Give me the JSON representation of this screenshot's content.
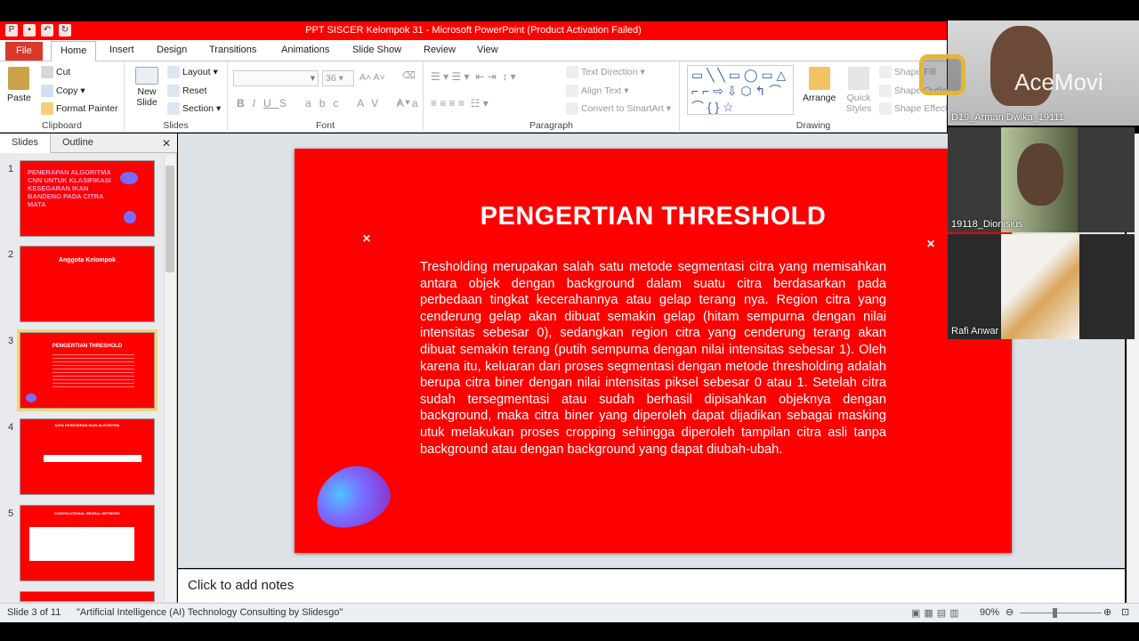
{
  "window": {
    "title": "PPT SISCER Kelompok 31 - Microsoft PowerPoint (Product Activation Failed)"
  },
  "ribbon_tabs": [
    "File",
    "Home",
    "Insert",
    "Design",
    "Transitions",
    "Animations",
    "Slide Show",
    "Review",
    "View"
  ],
  "clipboard": {
    "paste": "Paste",
    "cut": "Cut",
    "copy": "Copy",
    "format_painter": "Format Painter",
    "label": "Clipboard"
  },
  "slides_group": {
    "new_slide": "New Slide",
    "layout": "Layout",
    "reset": "Reset",
    "section": "Section",
    "label": "Slides"
  },
  "font_group": {
    "size": "36",
    "label": "Font"
  },
  "paragraph_group": {
    "text_direction": "Text Direction",
    "align_text": "Align Text",
    "convert": "Convert to SmartArt",
    "label": "Paragraph"
  },
  "drawing_group": {
    "arrange": "Arrange",
    "quick_styles": "Quick Styles",
    "shape_fill": "Shape Fill",
    "shape_outline": "Shape Outline",
    "shape_effects": "Shape Effects",
    "label": "Drawing"
  },
  "pane": {
    "tab_slides": "Slides",
    "tab_outline": "Outline"
  },
  "thumbnails": [
    {
      "num": "1",
      "title": "PENERAPAN ALGORITMA CNN UNTUK KLASIFIKASI KESEGARAN IKAN BANDENG PADA CITRA MATA"
    },
    {
      "num": "2",
      "title": "Anggota Kelompok"
    },
    {
      "num": "3",
      "title": "PENGERTIAN THRESHOLD"
    },
    {
      "num": "4",
      "title": "DATA KESEGERAN IKAN ALGORITMA"
    },
    {
      "num": "5",
      "title": "CONVOLUTIONAL NEURAL NETWORK"
    }
  ],
  "slide": {
    "title": "PENGERTIAN THRESHOLD",
    "body": "Tresholding merupakan salah satu metode segmentasi citra yang memisahkan antara objek dengan background dalam suatu citra berdasarkan pada perbedaan tingkat kecerahannya atau gelap terang nya. Region citra yang cenderung gelap akan dibuat semakin gelap (hitam sempurna dengan nilai intensitas sebesar 0), sedangkan region citra yang cenderung terang akan dibuat semakin terang (putih sempurna dengan nilai intensitas sebesar 1). Oleh karena itu, keluaran dari proses segmentasi dengan metode thresholding adalah berupa citra biner dengan nilai intensitas piksel sebesar 0 atau 1. Setelah citra sudah tersegmentasi atau sudah berhasil dipisahkan objeknya dengan background, maka citra biner yang diperoleh dapat dijadikan sebagai masking utuk melakukan proses cropping sehingga diperoleh tampilan citra asli tanpa background atau dengan background yang dapat diubah-ubah."
  },
  "notes_placeholder": "Click to add notes",
  "status": {
    "slide_info": "Slide 3 of 11",
    "theme": "\"Artificial Intelligence (AI) Technology Consulting by Slidesgo\"",
    "zoom": "90%"
  },
  "overlay": {
    "logo_text": "AceMovi",
    "participants": [
      "D19_Arman Dwika_19111",
      "19118_Dionisius",
      "Rafi Anwar"
    ]
  },
  "colors": {
    "accent": "#ff0000",
    "ribbon_bg": "#ffffff",
    "canvas_bg": "#dde2e7"
  }
}
